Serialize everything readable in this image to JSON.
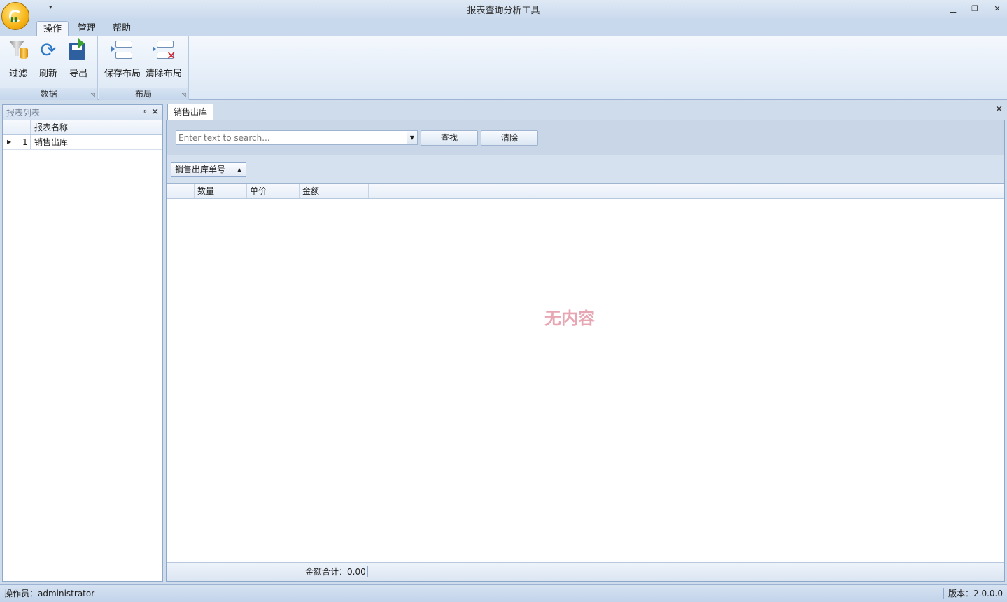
{
  "window": {
    "title": "报表查询分析工具",
    "qat_dropdown": "▾",
    "minimize": "▁",
    "restore": "❐",
    "close": "✕"
  },
  "ribbon": {
    "tabs": [
      {
        "label": "操作",
        "active": true
      },
      {
        "label": "管理",
        "active": false
      },
      {
        "label": "帮助",
        "active": false
      }
    ],
    "groups": [
      {
        "label": "数据",
        "buttons": [
          {
            "label": "过滤",
            "icon": "filter-icon"
          },
          {
            "label": "刷新",
            "icon": "refresh-icon"
          },
          {
            "label": "导出",
            "icon": "export-icon"
          }
        ]
      },
      {
        "label": "布局",
        "buttons": [
          {
            "label": "保存布局",
            "icon": "save-layout-icon"
          },
          {
            "label": "清除布局",
            "icon": "clear-layout-icon"
          }
        ]
      }
    ]
  },
  "left_panel": {
    "title": "报表列表",
    "pin": "𝟵",
    "close": "✕",
    "column": "报表名称",
    "rows": [
      {
        "index": "1",
        "name": "销售出库"
      }
    ]
  },
  "doc": {
    "tab": "销售出库",
    "close": "✕",
    "search": {
      "placeholder": "Enter text to search...",
      "find_label": "查找",
      "clear_label": "清除"
    },
    "group_by": "销售出库单号",
    "columns": [
      "数量",
      "单价",
      "金额"
    ],
    "empty_text": "无内容",
    "summary": "金额合计：0.00"
  },
  "status": {
    "operator": "操作员：administrator",
    "version": "版本：2.0.0.0"
  }
}
